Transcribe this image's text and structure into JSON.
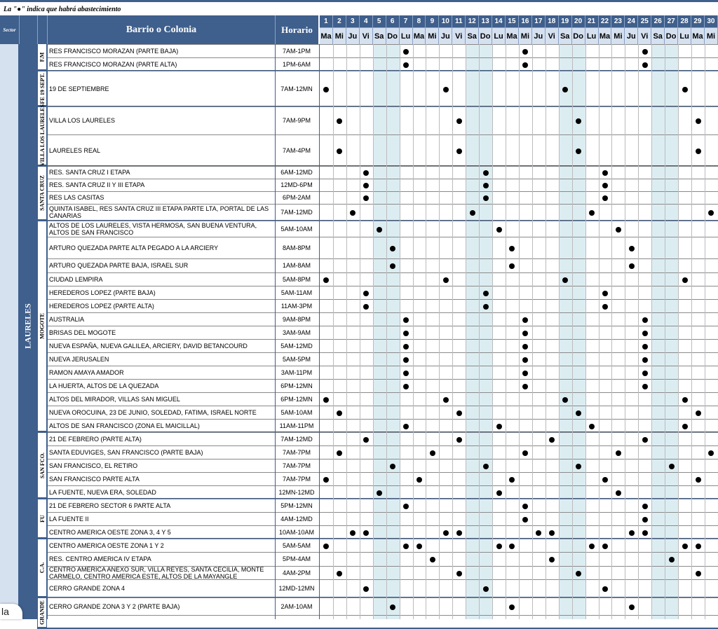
{
  "note": "La \"●\" indica que habrá abastecimiento",
  "headers": {
    "sector": "Sector",
    "barrio": "Barrio o Colonia",
    "horario": "Horario"
  },
  "days": [
    "Ma",
    "Mi",
    "Ju",
    "Vi",
    "Sa",
    "Do",
    "Lu",
    "Ma",
    "Mi",
    "Ju",
    "Vi",
    "Sa",
    "Do",
    "Lu",
    "Ma",
    "Mi",
    "Ju",
    "Vi",
    "Sa",
    "Do",
    "Lu",
    "Ma",
    "Mi",
    "Ju",
    "Vi",
    "Sa",
    "Do",
    "Lu",
    "Ma",
    "Mi"
  ],
  "dates": [
    1,
    2,
    3,
    4,
    5,
    6,
    7,
    8,
    9,
    10,
    11,
    12,
    13,
    14,
    15,
    16,
    17,
    18,
    19,
    20,
    21,
    22,
    23,
    24,
    25,
    26,
    27,
    28,
    29,
    30
  ],
  "zone": "LAURELES",
  "groups": [
    {
      "label": "F.M",
      "start": 0,
      "end": 1
    },
    {
      "label": "FE 19 SEPT.",
      "start": 2,
      "end": 2
    },
    {
      "label": "VILLA LOS LAURELES",
      "start": 3,
      "end": 4
    },
    {
      "label": "SANTA CRUZ",
      "start": 5,
      "end": 8
    },
    {
      "label": "MOGOTE",
      "start": 9,
      "end": 23
    },
    {
      "label": "SAN FCO.",
      "start": 24,
      "end": 28
    },
    {
      "label": "FU",
      "start": 29,
      "end": 31
    },
    {
      "label": "C.A.",
      "start": 32,
      "end": 35
    },
    {
      "label": "GRANDE",
      "start": 36,
      "end": 37
    }
  ],
  "rows": [
    {
      "barrio": "RES FRANCISCO MORAZAN  (PARTE BAJA)",
      "horario": "7AM-1PM",
      "dots": [
        7,
        16,
        25
      ]
    },
    {
      "barrio": "RES FRANCISCO MORAZAN  (PARTE ALTA)",
      "horario": "1PM-6AM",
      "dots": [
        7,
        16,
        25
      ]
    },
    {
      "barrio": "19 DE SEPTIEMBRE",
      "horario": "7AM-12MN",
      "dots": [
        1,
        10,
        19,
        28
      ]
    },
    {
      "barrio": "VILLA LOS LAURELES",
      "horario": "7AM-9PM",
      "dots": [
        2,
        11,
        20,
        29
      ]
    },
    {
      "barrio": "LAURELES REAL",
      "horario": "7AM-4PM",
      "dots": [
        2,
        11,
        20,
        29
      ]
    },
    {
      "barrio": "RES. SANTA CRUZ I ETAPA",
      "horario": "6AM-12MD",
      "dots": [
        4,
        13,
        22
      ]
    },
    {
      "barrio": "RES. SANTA CRUZ II Y III ETAPA",
      "horario": "12MD-6PM",
      "dots": [
        4,
        13,
        22
      ]
    },
    {
      "barrio": "RES LAS CASITAS",
      "horario": "6PM-2AM",
      "dots": [
        4,
        13,
        22
      ]
    },
    {
      "barrio": "QUINTA ISABEL, RES SANTA CRUZ III ETAPA PARTE LTA, PORTAL DE LAS CANARIAS",
      "horario": "7AM-12MD",
      "dots": [
        3,
        12,
        21,
        30
      ]
    },
    {
      "barrio": "ALTOS DE LOS LAURELES, VISTA HERMOSA, SAN BUENA VENTURA, ALTOS DE SAN FRANCISCO",
      "horario": "5AM-10AM",
      "dots": [
        5,
        14,
        23
      ]
    },
    {
      "barrio": "ARTURO QUEZADA PARTE ALTA PEGADO A LA ARCIERY",
      "horario": "8AM-8PM",
      "dots": [
        6,
        15,
        24
      ]
    },
    {
      "barrio": "ARTURO QUEZADA PARTE BAJA, ISRAEL SUR",
      "horario": "1AM-8AM",
      "dots": [
        6,
        15,
        24
      ]
    },
    {
      "barrio": "CIUDAD LEMPIRA",
      "horario": "5AM-8PM",
      "dots": [
        1,
        10,
        19,
        28
      ]
    },
    {
      "barrio": "HEREDEROS LOPEZ (PARTE BAJA)",
      "horario": "5AM-11AM",
      "dots": [
        4,
        13,
        22
      ]
    },
    {
      "barrio": "HEREDEROS LOPEZ (PARTE ALTA)",
      "horario": "11AM-3PM",
      "dots": [
        4,
        13,
        22
      ]
    },
    {
      "barrio": "AUSTRALIA",
      "horario": "9AM-8PM",
      "dots": [
        7,
        16,
        25
      ]
    },
    {
      "barrio": "BRISAS DEL MOGOTE",
      "horario": "3AM-9AM",
      "dots": [
        7,
        16,
        25
      ]
    },
    {
      "barrio": "NUEVA ESPAÑA, NUEVA GALILEA, ARCIERY, DAVID BETANCOURD",
      "horario": "5AM-12MD",
      "dots": [
        7,
        16,
        25
      ]
    },
    {
      "barrio": "NUEVA JERUSALEN",
      "horario": "5AM-5PM",
      "dots": [
        7,
        16,
        25
      ]
    },
    {
      "barrio": "RAMON AMAYA AMADOR",
      "horario": "3AM-11PM",
      "dots": [
        7,
        16,
        25
      ]
    },
    {
      "barrio": "LA HUERTA, ALTOS DE LA QUEZADA",
      "horario": "6PM-12MN",
      "dots": [
        7,
        16,
        25
      ]
    },
    {
      "barrio": "ALTOS DEL MIRADOR, VILLAS SAN MIGUEL",
      "horario": "6PM-12MN",
      "dots": [
        1,
        10,
        19,
        28
      ]
    },
    {
      "barrio": "NUEVA OROCUINA, 23 DE JUNIO, SOLEDAD, FATIMA, ISRAEL NORTE",
      "horario": "5AM-10AM",
      "dots": [
        2,
        11,
        20,
        29
      ]
    },
    {
      "barrio": "ALTOS DE SAN FRANCISCO (ZONA EL MAICILLAL)",
      "horario": "11AM-11PM",
      "dots": [
        7,
        14,
        21,
        28
      ]
    },
    {
      "barrio": "21 DE FEBRERO (PARTE ALTA)",
      "horario": "7AM-12MD",
      "dots": [
        4,
        11,
        18,
        25
      ]
    },
    {
      "barrio": "SANTA EDUVIGES, SAN FRANCISCO (PARTE BAJA)",
      "horario": "7AM-7PM",
      "dots": [
        2,
        9,
        16,
        23,
        30
      ]
    },
    {
      "barrio": "SAN FRANCISCO, EL RETIRO",
      "horario": "7AM-7PM",
      "dots": [
        6,
        13,
        20,
        27
      ]
    },
    {
      "barrio": "SAN FRANCISCO PARTE ALTA",
      "horario": "7AM-7PM",
      "dots": [
        1,
        8,
        15,
        22,
        29
      ]
    },
    {
      "barrio": "LA FUENTE, NUEVA ERA, SOLEDAD",
      "horario": "12MN-12MD",
      "dots": [
        5,
        14,
        23
      ]
    },
    {
      "barrio": "21 DE FEBRERO SECTOR 6 PARTE ALTA",
      "horario": "5PM-12MN",
      "dots": [
        7,
        16,
        25
      ]
    },
    {
      "barrio": "LA FUENTE II",
      "horario": "4AM-12MD",
      "dots": [
        16,
        25
      ]
    },
    {
      "barrio": "CENTRO AMERICA  OESTE ZONA 3, 4 Y 5",
      "horario": "10AM-10AM",
      "dots": [
        3,
        4,
        10,
        11,
        17,
        18,
        24,
        25
      ]
    },
    {
      "barrio": "CENTRO AMERICA  OESTE ZONA 1 Y 2",
      "horario": "5AM-5AM",
      "dots": [
        1,
        7,
        8,
        14,
        15,
        21,
        22,
        28,
        29
      ]
    },
    {
      "barrio": "RES. CENTRO AMERICA IV ETAPA",
      "horario": "5PM-4AM",
      "dots": [
        9,
        18,
        27
      ]
    },
    {
      "barrio": "CENTRO AMERICA ANEXO SUR, VILLA REYES, SANTA CECILIA, MONTE CARMELO, CENTRO AMERICA ESTE, ALTOS DE LA MAYANGLE",
      "horario": "4AM-2PM",
      "dots": [
        2,
        11,
        20,
        29
      ]
    },
    {
      "barrio": "CERRO GRANDE ZONA 4",
      "horario": "12MD-12MN",
      "dots": [
        4,
        13,
        22
      ]
    },
    {
      "barrio": "CERRO GRANDE ZONA 3 Y 2 (PARTE BAJA)",
      "horario": "2AM-10AM",
      "dots": [
        6,
        15,
        24
      ]
    }
  ],
  "fragment": "la"
}
